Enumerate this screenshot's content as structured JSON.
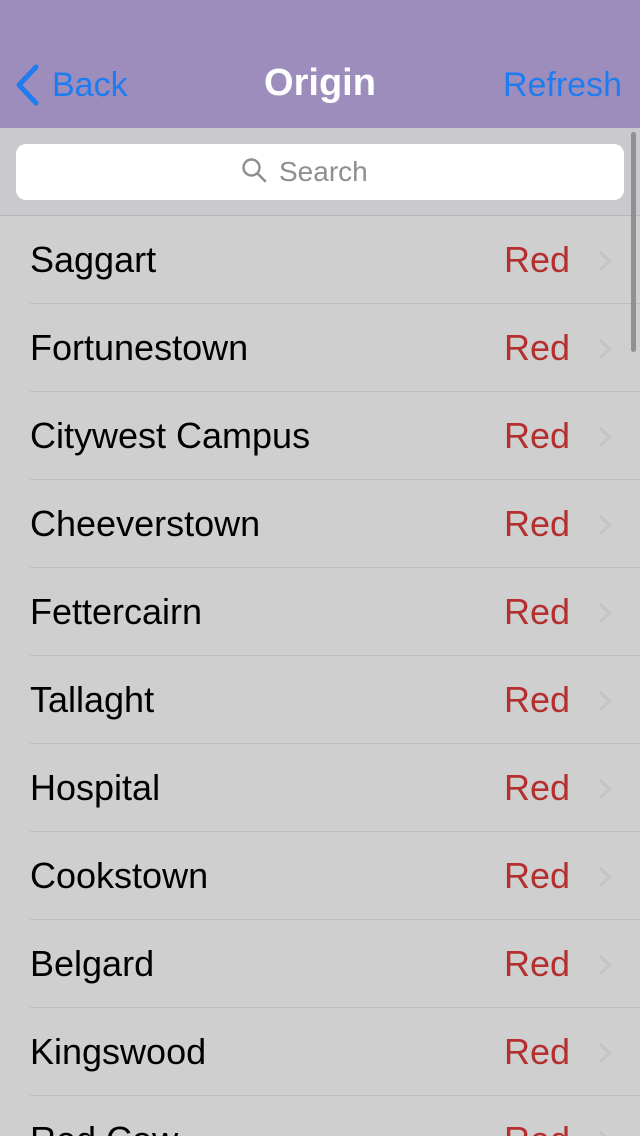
{
  "navbar": {
    "back_label": "Back",
    "title": "Origin",
    "refresh_label": "Refresh"
  },
  "search": {
    "placeholder": "Search",
    "value": ""
  },
  "list": {
    "items": [
      {
        "name": "Saggart",
        "line": "Red"
      },
      {
        "name": "Fortunestown",
        "line": "Red"
      },
      {
        "name": "Citywest Campus",
        "line": "Red"
      },
      {
        "name": "Cheeverstown",
        "line": "Red"
      },
      {
        "name": "Fettercairn",
        "line": "Red"
      },
      {
        "name": "Tallaght",
        "line": "Red"
      },
      {
        "name": "Hospital",
        "line": "Red"
      },
      {
        "name": "Cookstown",
        "line": "Red"
      },
      {
        "name": "Belgard",
        "line": "Red"
      },
      {
        "name": "Kingswood",
        "line": "Red"
      },
      {
        "name": "Red Cow",
        "line": "Red"
      }
    ]
  },
  "colors": {
    "navbar_bg": "#9d8dbd",
    "accent_blue": "#1f7cf0",
    "line_red": "#b3302e",
    "list_bg": "#cfcfcf"
  },
  "icons": {
    "back": "chevron-left-icon",
    "search": "magnifier-icon",
    "disclosure": "chevron-right-icon"
  }
}
